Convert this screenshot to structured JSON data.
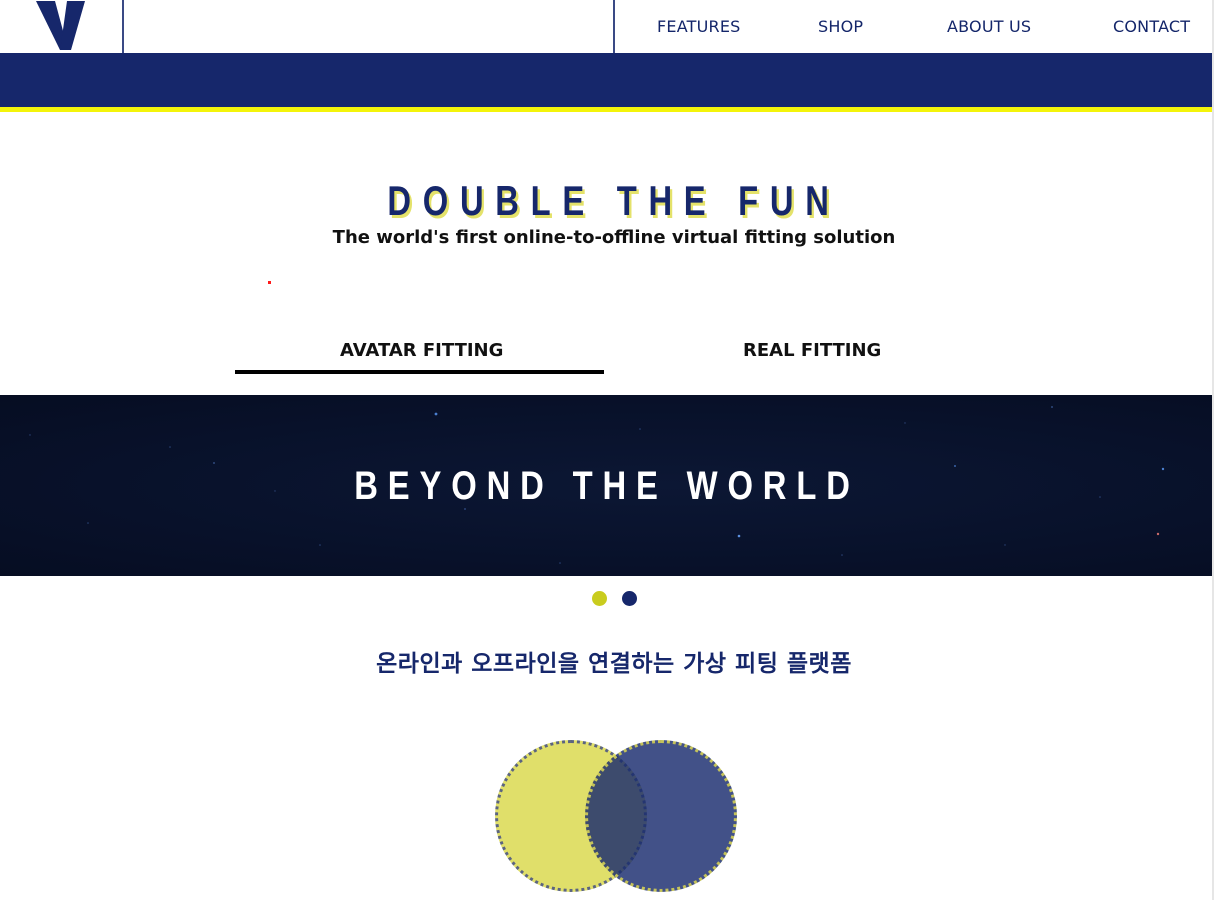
{
  "header": {
    "logo_icon": "v-logo-icon",
    "nav": [
      {
        "label": "FEATURES"
      },
      {
        "label": "SHOP"
      },
      {
        "label": "ABOUT US"
      },
      {
        "label": "CONTACT"
      }
    ]
  },
  "colors": {
    "navy": "#16276b",
    "yellow_accent": "#f4f40a",
    "lime": "#c9cc1e",
    "banner_bg": "#08112a"
  },
  "hero": {
    "title": "DOUBLE THE FUN",
    "subtitle": "The world's first online-to-offline virtual fitting solution"
  },
  "tabs": [
    {
      "label": "AVATAR FITTING",
      "active": true
    },
    {
      "label": "REAL FITTING",
      "active": false
    }
  ],
  "banner": {
    "title": "BEYOND THE WORLD"
  },
  "carousel": {
    "total": 2,
    "active": 1
  },
  "tagline": "온라인과 오프라인을 연결하는 가상 피팅 플랫폼"
}
